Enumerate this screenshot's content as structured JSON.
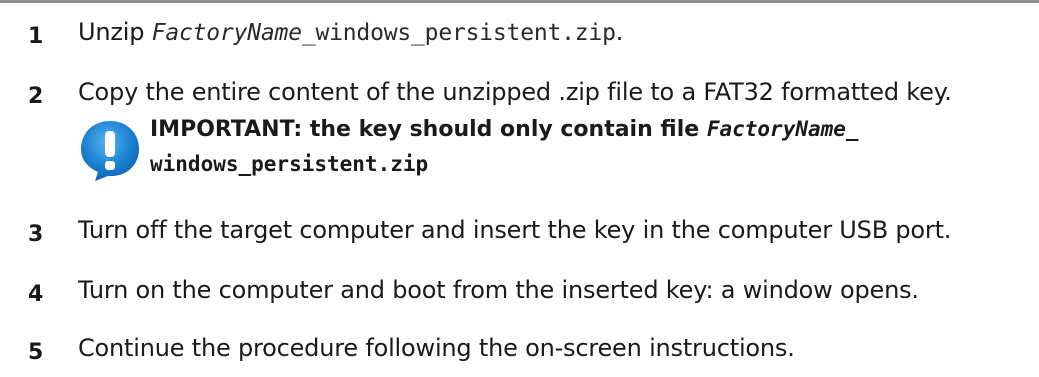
{
  "steps": [
    {
      "number": "1",
      "prefix": "Unzip ",
      "code_italic": "FactoryName",
      "code": "_windows_persistent.zip",
      "suffix": "."
    },
    {
      "number": "2",
      "text": "Copy the entire content of the unzipped .zip file to a FAT32 formatted key."
    },
    {
      "number": "3",
      "text": "Turn off the target computer and insert the key in the computer USB port."
    },
    {
      "number": "4",
      "text": "Turn on the computer and boot from the inserted key: a window opens."
    },
    {
      "number": "5",
      "text": "Continue the procedure following the on-screen instructions."
    }
  ],
  "note": {
    "icon": "exclamation-icon",
    "icon_color": "#1a7fd1",
    "text": "IMPORTANT: the key should only contain file ",
    "code_italic": "FactoryName",
    "code_line1": "_",
    "code_line2": "windows_persistent.zip"
  }
}
